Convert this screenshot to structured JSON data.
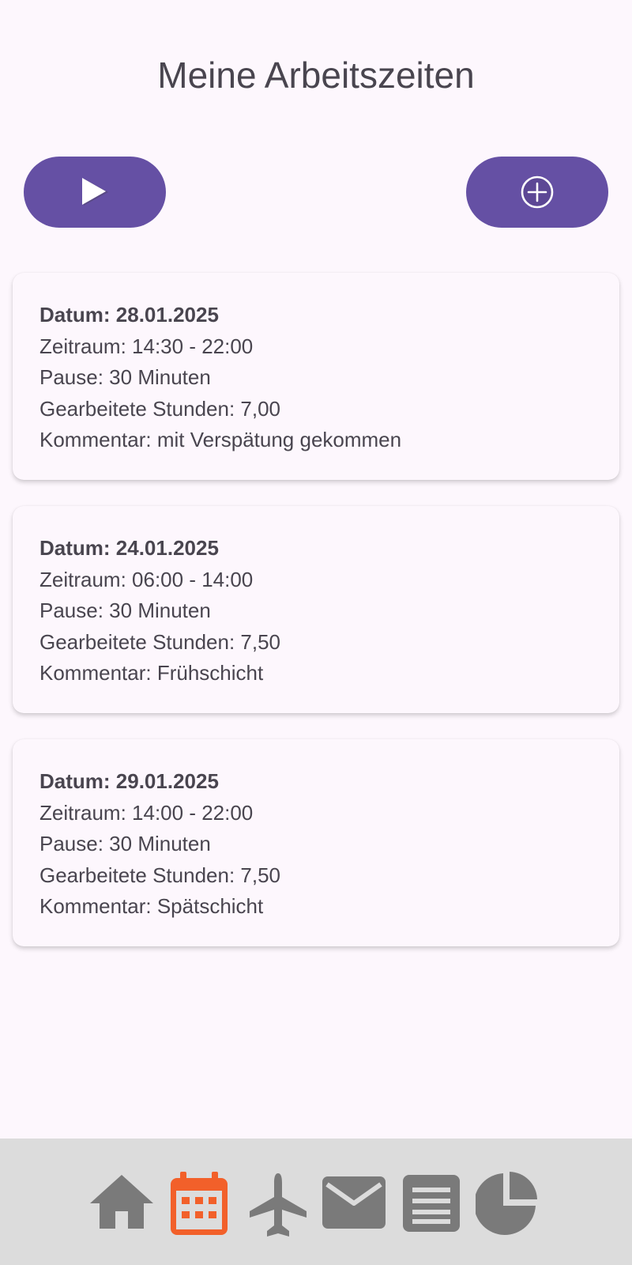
{
  "header": {
    "title": "Meine Arbeitszeiten"
  },
  "actions": {
    "start_icon": "play-icon",
    "add_icon": "add-circle-icon",
    "accent_color": "#6550a4"
  },
  "entries": [
    {
      "date": "Datum: 28.01.2025",
      "period": "Zeitraum: 14:30 - 22:00",
      "pause": "Pause: 30 Minuten",
      "hours": "Gearbeitete Stunden: 7,00",
      "comment": "Kommentar: mit Verspätung gekommen"
    },
    {
      "date": "Datum: 24.01.2025",
      "period": "Zeitraum: 06:00 - 14:00",
      "pause": "Pause: 30 Minuten",
      "hours": "Gearbeitete Stunden: 7,50",
      "comment": "Kommentar: Frühschicht"
    },
    {
      "date": "Datum: 29.01.2025",
      "period": "Zeitraum: 14:00 - 22:00",
      "pause": "Pause: 30 Minuten",
      "hours": "Gearbeitete Stunden: 7,50",
      "comment": "Kommentar: Spätschicht"
    }
  ],
  "bottom_nav": {
    "items": [
      "home-icon",
      "calendar-icon",
      "airplane-icon",
      "mail-icon",
      "list-icon",
      "pie-chart-icon"
    ],
    "active": "calendar-icon",
    "active_color": "#f2602a",
    "inactive_color": "#7a7a7a",
    "background": "#dcdcdc"
  }
}
